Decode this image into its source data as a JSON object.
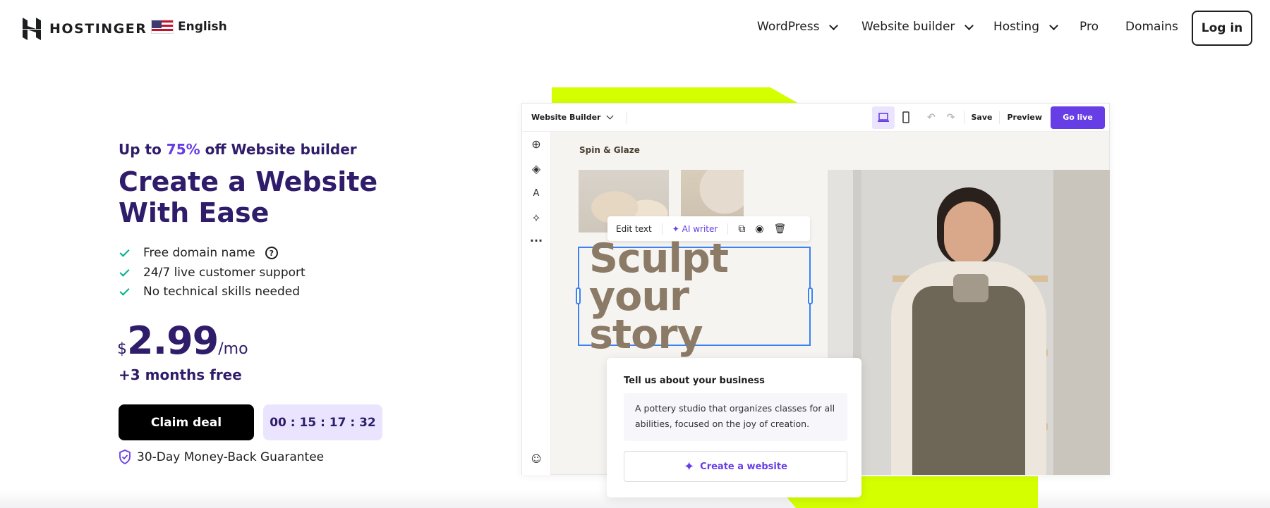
{
  "brand": {
    "name": "HOSTINGER",
    "language": "English"
  },
  "nav": {
    "items": [
      {
        "label": "WordPress",
        "dropdown": true
      },
      {
        "label": "Website builder",
        "dropdown": true
      },
      {
        "label": "Hosting",
        "dropdown": true
      },
      {
        "label": "Pro",
        "dropdown": false
      },
      {
        "label": "Domains",
        "dropdown": false
      }
    ],
    "login": "Log in"
  },
  "hero": {
    "promo_prefix": "Up to",
    "promo_discount": "75%",
    "promo_suffix": "off Website builder",
    "title": "Create a Website With Ease",
    "features": [
      "Free domain name",
      "24/7 live customer support",
      "No technical skills needed"
    ],
    "price": {
      "currency": "$",
      "amount": "2.99",
      "period": "/mo"
    },
    "bonus": "+3 months free",
    "cta": "Claim deal",
    "timer": "00 : 15 : 17 : 32",
    "guarantee": "30-Day Money-Back Guarantee"
  },
  "builder": {
    "dropdown": "Website Builder",
    "save": "Save",
    "preview": "Preview",
    "go_live": "Go live",
    "site_name": "Spin & Glaze",
    "edit_text": "Edit text",
    "ai_writer": "AI writer",
    "headline_line1": "Sculpt",
    "headline_line2": "your story",
    "card_title": "Tell us about your business",
    "card_text": "A pottery studio that organizes classes for all abilities, focused on the joy of creation.",
    "card_button": "Create a website"
  },
  "colors": {
    "accent": "#673de6",
    "heading": "#2f1c6a",
    "lime": "#d4ff00",
    "check": "#00b090",
    "timer_bg": "#ebe4ff"
  }
}
